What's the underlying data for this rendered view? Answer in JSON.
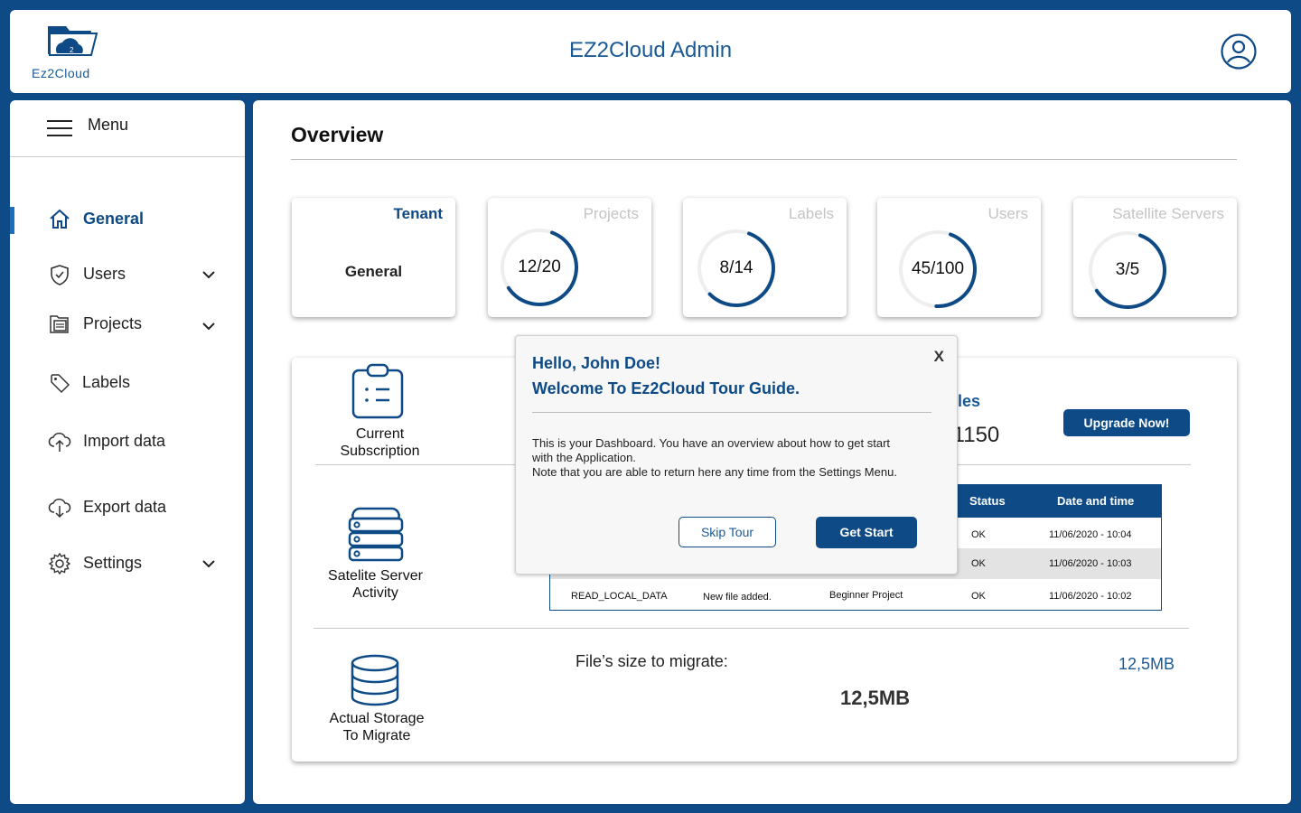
{
  "header": {
    "logo_text": "Ez2Cloud",
    "title": "EZ2Cloud Admin",
    "user_icon": "user-circle-icon"
  },
  "sidebar": {
    "menu_label": "Menu",
    "items": [
      {
        "label": "General",
        "icon": "home-icon",
        "active": true
      },
      {
        "label": "Users",
        "icon": "shield-icon",
        "has_submenu": true
      },
      {
        "label": "Projects",
        "icon": "folder-stack-icon",
        "has_submenu": true
      },
      {
        "label": "Labels",
        "icon": "tag-icon"
      },
      {
        "label": "Import data",
        "icon": "cloud-upload-icon"
      },
      {
        "label": "Export data",
        "icon": "cloud-download-icon"
      },
      {
        "label": "Settings",
        "icon": "gear-icon",
        "has_submenu": true
      }
    ]
  },
  "overview": {
    "title": "Overview",
    "cards": {
      "tenant": {
        "title": "Tenant",
        "value": "General"
      },
      "projects": {
        "title": "Projects",
        "value": "12/20",
        "fraction": 0.6
      },
      "labels": {
        "title": "Labels",
        "value": "8/14",
        "fraction": 0.571
      },
      "users": {
        "title": "Users",
        "value": "45/100",
        "fraction": 0.45
      },
      "satellite": {
        "title": "Satellite Servers",
        "value": "3/5",
        "fraction": 0.6
      }
    }
  },
  "subscription": {
    "label_line1": "Current",
    "label_line2": "Subscription",
    "files_fragment": "les",
    "count_fragment": "/1150",
    "upgrade_label": "Upgrade Now!"
  },
  "activity": {
    "label_line1": "Satelite Server",
    "label_line2": "Activity",
    "columns": {
      "status": "Status",
      "datetime": "Date and time"
    },
    "rows": [
      {
        "status": "OK",
        "datetime": "11/06/2020 - 10:04"
      },
      {
        "status": "OK",
        "datetime": "11/06/2020 - 10:03"
      },
      {
        "action": "READ_LOCAL_DATA",
        "message": "New file added.",
        "project": "Beginner Project",
        "status": "OK",
        "datetime": "11/06/2020 - 10:02"
      }
    ]
  },
  "storage": {
    "label_line1": "Actual Storage",
    "label_line2": "To Migrate",
    "files_label": "File’s size to migrate:",
    "size": "12,5MB",
    "size_right": "12,5MB"
  },
  "tour_modal": {
    "close": "X",
    "hello": "Hello, John Doe!",
    "welcome": "Welcome To Ez2Cloud Tour Guide.",
    "body_line1": "This is your Dashboard. You have an overview about how to get start",
    "body_line2": "with the Application.",
    "body_line3": "Note that you are able to return here any time from the Settings Menu.",
    "skip_label": "Skip Tour",
    "start_label": "Get Start"
  },
  "colors": {
    "brand": "#0d4a86",
    "accent": "#1a5a96",
    "ring_track": "#eeeeee"
  }
}
